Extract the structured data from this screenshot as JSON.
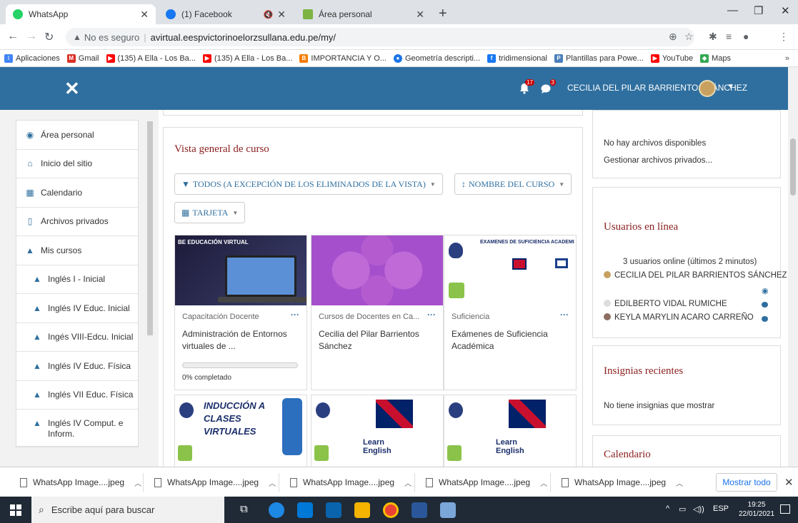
{
  "browser": {
    "tabs": [
      {
        "title": "WhatsApp",
        "icon": "whatsapp-icon",
        "color": "#25d366"
      },
      {
        "title": "(1) Facebook",
        "icon": "facebook-icon",
        "color": "#1877f2"
      },
      {
        "title": "Área personal",
        "icon": "moodle-tab-icon",
        "color": "#7cb342"
      }
    ],
    "address": {
      "security_text": "No es seguro",
      "url": "avirtual.eespvictorinoelorzsullana.edu.pe/my/"
    },
    "bookmarks": [
      {
        "label": "Aplicaciones",
        "color": "#4285f4",
        "icon": "apps-icon"
      },
      {
        "label": "Gmail",
        "color": "#d93025",
        "icon": "gmail-icon"
      },
      {
        "label": "(135) A Ella - Los Ba...",
        "color": "#ff0000",
        "icon": "youtube-icon"
      },
      {
        "label": "(135) A Ella - Los Ba...",
        "color": "#ff0000",
        "icon": "youtube-icon"
      },
      {
        "label": "IMPORTANCIA Y O...",
        "color": "#f57c00",
        "icon": "blogger-icon"
      },
      {
        "label": "Geometría descripti...",
        "color": "#1a73e8",
        "icon": "chrome-page-icon"
      },
      {
        "label": "tridimensional",
        "color": "#1877f2",
        "icon": "facebook-icon"
      },
      {
        "label": "Plantillas para Powe...",
        "color": "#4a7ebb",
        "icon": "plantillas-icon"
      },
      {
        "label": "YouTube",
        "color": "#ff0000",
        "icon": "youtube-icon"
      },
      {
        "label": "Maps",
        "color": "#34a853",
        "icon": "maps-icon"
      }
    ]
  },
  "navbar": {
    "notifications_count": "17",
    "messages_count": "3",
    "user_name": "CECILIA DEL PILAR BARRIENTOS SÁNCHEZ",
    "brand_color": "#2f6f9f"
  },
  "drawer": {
    "items": [
      {
        "label": "Área personal",
        "icon": "dashboard-icon"
      },
      {
        "label": "Inicio del sitio",
        "icon": "home-icon"
      },
      {
        "label": "Calendario",
        "icon": "calendar-icon"
      },
      {
        "label": "Archivos privados",
        "icon": "file-icon"
      },
      {
        "label": "Mis cursos",
        "icon": "graduation-cap-icon"
      },
      {
        "label": "Inglés I - Inicial",
        "icon": "graduation-cap-icon"
      },
      {
        "label": "Inglés IV Educ. Inicial",
        "icon": "graduation-cap-icon"
      },
      {
        "label": "Ingés VIII-Edcu. Inicial",
        "icon": "graduation-cap-icon"
      },
      {
        "label": "Inglés IV Educ. Física",
        "icon": "graduation-cap-icon"
      },
      {
        "label": "Inglés VII Educ. Física",
        "icon": "graduation-cap-icon"
      },
      {
        "label": "Inglés IV Comput. e Inform.",
        "icon": "graduation-cap-icon"
      }
    ]
  },
  "overview": {
    "title": "Vista general de curso",
    "filter_label": "TODOS (A EXCEPCIÓN DE LOS ELIMINADOS DE LA VISTA)",
    "sort_label": "NOMBRE DEL CURSO",
    "view_label": "TARJETA",
    "cards": [
      {
        "category": "Capacitación Docente",
        "name": "Administración de Entornos virtuales de ...",
        "progress_text": "0% completado",
        "progress": 0,
        "img_text": "BE EDUCACIÓN VIRTUAL"
      },
      {
        "category": "Cursos de Docentes en Ca...",
        "name": "Cecilia del Pilar Barrientos Sánchez"
      },
      {
        "category": "Suficiencia",
        "name": "Exámenes de Suficiencia Académica",
        "img_text": "EXÁMENES DE SUFICIENCIA ACADÉMICA"
      },
      {
        "img_text": "INDUCCIÓN A CLASES VIRTUALES"
      },
      {
        "img_text": "Learn English"
      },
      {
        "img_text": "Learn English"
      }
    ]
  },
  "private_files": {
    "empty_text": "No hay archivos disponibles",
    "manage_link": "Gestionar archivos privados..."
  },
  "online_users": {
    "title": "Usuarios en línea",
    "summary": "3 usuarios online (últimos 2 minutos)",
    "users": [
      "CECILIA DEL PILAR BARRIENTOS SÁNCHEZ",
      "EDILBERTO VIDAL RUMICHE",
      "KEYLA MARYLIN ACARO CARREÑO"
    ]
  },
  "badges": {
    "title": "Insignias recientes",
    "empty_text": "No tiene insignias que mostrar"
  },
  "calendar": {
    "title": "Calendario"
  },
  "downloads": {
    "items": [
      "WhatsApp Image....jpeg",
      "WhatsApp Image....jpeg",
      "WhatsApp Image....jpeg",
      "WhatsApp Image....jpeg",
      "WhatsApp Image....jpeg"
    ],
    "show_all": "Mostrar todo"
  },
  "taskbar": {
    "search_placeholder": "Escribe aquí para buscar",
    "language": "ESP",
    "time": "19:25",
    "date": "22/01/2021"
  }
}
